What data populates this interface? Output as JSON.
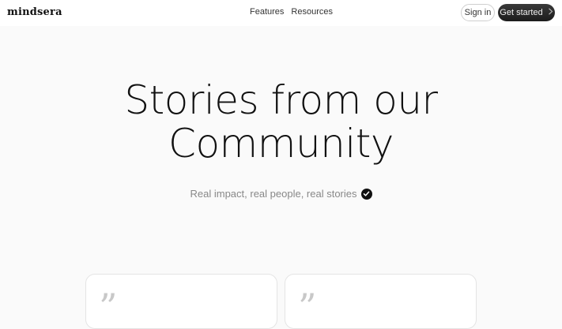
{
  "header": {
    "logo": "mindsera",
    "nav": [
      "Features",
      "Resources"
    ],
    "signin_label": "Sign in",
    "cta_label": "Get started",
    "cta_icon": "chevron-right-icon"
  },
  "hero": {
    "title_line1": "Stories from our",
    "title_line2": "Community",
    "subtitle": "Real impact, real people, real stories",
    "badge_icon": "verified-check-icon"
  },
  "cards": [
    {
      "quote_mark": "”"
    },
    {
      "quote_mark": "”"
    }
  ],
  "colors": {
    "background": "#fafafa",
    "cta_bg": "#2a2a2a",
    "text": "#111111",
    "muted": "#888888"
  }
}
